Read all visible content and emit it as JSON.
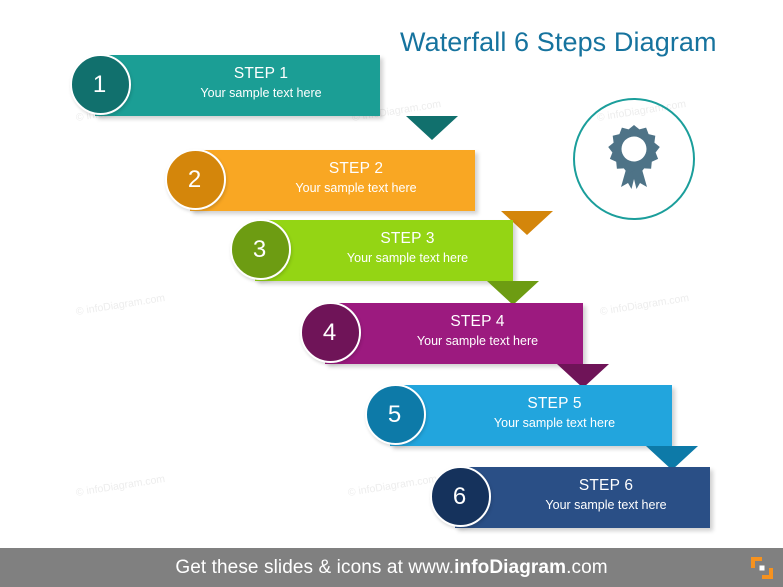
{
  "title": "Waterfall 6 Steps Diagram",
  "title_color": "#16739e",
  "steps": [
    {
      "number": "1",
      "heading": "STEP 1",
      "subtext": "Your sample text here",
      "bar_color": "#1b9e95",
      "circle_color": "#11706d",
      "arrow_color": "#11706d"
    },
    {
      "number": "2",
      "heading": "STEP 2",
      "subtext": "Your sample text here",
      "bar_color": "#f9a723",
      "circle_color": "#d4860b",
      "arrow_color": "#d4860b"
    },
    {
      "number": "3",
      "heading": "STEP 3",
      "subtext": "Your sample text here",
      "bar_color": "#94d514",
      "circle_color": "#6d9c12",
      "arrow_color": "#6d9c12"
    },
    {
      "number": "4",
      "heading": "STEP 4",
      "subtext": "Your sample text here",
      "bar_color": "#9c1a7f",
      "circle_color": "#6f1458",
      "arrow_color": "#6f1458"
    },
    {
      "number": "5",
      "heading": "STEP 5",
      "subtext": "Your sample text here",
      "bar_color": "#22a5dd",
      "circle_color": "#0d7aa8",
      "arrow_color": "#0d7aa8"
    },
    {
      "number": "6",
      "heading": "STEP 6",
      "subtext": "Your sample text here",
      "bar_color": "#2a4f86",
      "circle_color": "#15325c",
      "arrow_color": "#15325c"
    }
  ],
  "icon": {
    "name": "award-ribbon-icon",
    "ring_color": "#1b9e9b",
    "glyph_color": "#4e7387"
  },
  "watermarks": [
    "© infoDiagram.com",
    "© infoDiagram.com",
    "© infoDiagram.com",
    "© infoDiagram.com",
    "© infoDiagram.com",
    "© infoDiagram.com",
    "© infoDiagram.com"
  ],
  "footer": {
    "prefix": "Get these slides &  icons at www.",
    "brand": "infoDiagram",
    "suffix": ".com",
    "background": "#808080",
    "logo_color": "#f6921e"
  }
}
